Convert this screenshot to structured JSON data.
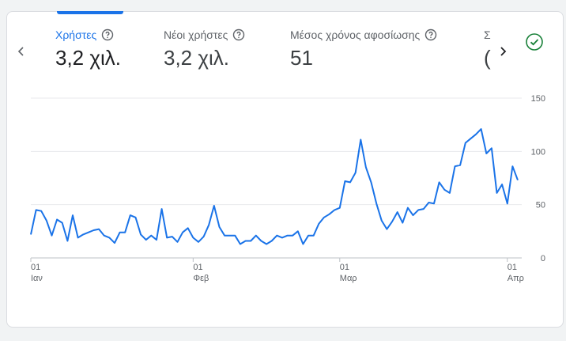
{
  "metrics": [
    {
      "label": "Χρήστες",
      "value": "3,2 χιλ.",
      "active": true
    },
    {
      "label": "Νέοι χρήστες",
      "value": "3,2 χιλ.",
      "active": false
    },
    {
      "label": "Μέσος χρόνος αφοσίωσης",
      "value": "51",
      "active": false
    }
  ],
  "truncated_metric_label": "Σ",
  "truncated_metric_value": "(",
  "icons": {
    "prev": "chevron-left-icon",
    "next": "chevron-right-icon",
    "help": "help-circle-icon",
    "status": "check-circle-icon"
  },
  "colors": {
    "accent": "#1a73e8",
    "line": "#1a73e8",
    "grid": "#e8eaed",
    "status": "#188038"
  },
  "chart_data": {
    "type": "line",
    "x_ticks": [
      {
        "day": "01",
        "month": "Ιαν"
      },
      {
        "day": "01",
        "month": "Φεβ"
      },
      {
        "day": "01",
        "month": "Μαρ"
      },
      {
        "day": "01",
        "month": "Απρ"
      }
    ],
    "y_ticks": [
      0,
      50,
      100,
      150
    ],
    "ylim": [
      0,
      150
    ],
    "grid": true,
    "series": [
      {
        "values": [
          22,
          45,
          44,
          35,
          21,
          36,
          33,
          16,
          40,
          19,
          22,
          24,
          26,
          27,
          21,
          19,
          14,
          24,
          24,
          40,
          38,
          22,
          17,
          21,
          17,
          46,
          19,
          20,
          15,
          24,
          28,
          19,
          15,
          20,
          31,
          49,
          29,
          21,
          21,
          21,
          13,
          16,
          16,
          21,
          16,
          13,
          16,
          21,
          19,
          21,
          21,
          25,
          13,
          21,
          21,
          32,
          38,
          41,
          45,
          47,
          72,
          71,
          80,
          111,
          85,
          71,
          51,
          35,
          27,
          34,
          43,
          33,
          47,
          40,
          45,
          46,
          52,
          51,
          71,
          64,
          61,
          86,
          87,
          108,
          112,
          116,
          121,
          98,
          103,
          61,
          69,
          51,
          86,
          73
        ]
      }
    ]
  }
}
